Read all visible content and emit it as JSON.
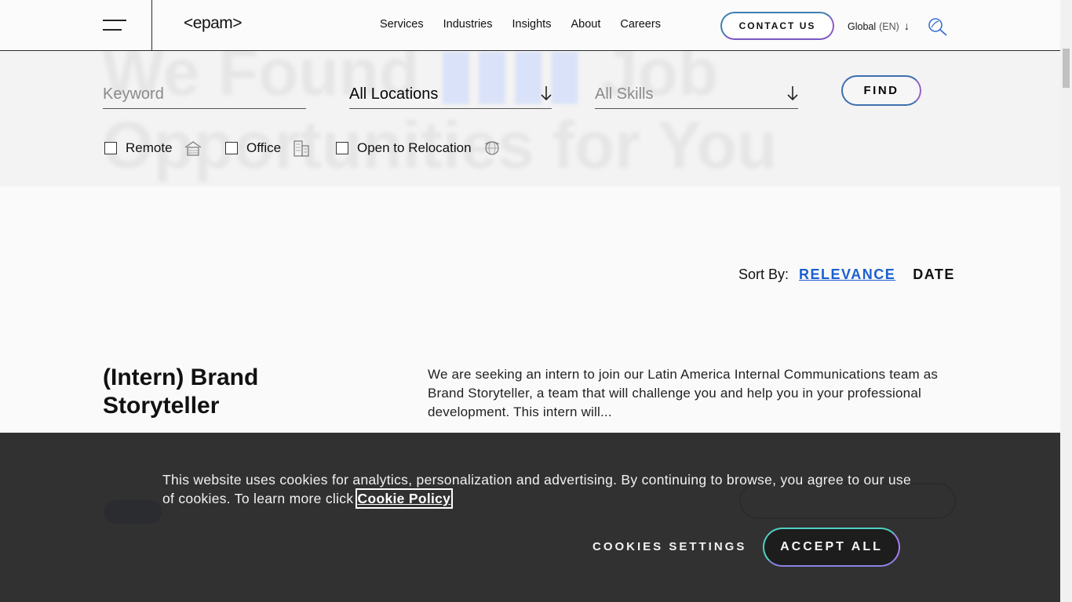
{
  "header": {
    "logo": "<epam>",
    "nav": [
      "Services",
      "Industries",
      "Insights",
      "About",
      "Careers"
    ],
    "contact_label": "CONTACT US",
    "lang_region": "Global",
    "lang_code": "(EN)"
  },
  "filters": {
    "keyword_placeholder": "Keyword",
    "location_value": "All Locations",
    "skills_value": "All Skills",
    "find_label": "FIND",
    "checkboxes": [
      {
        "label": "Remote",
        "checked": false,
        "icon": "house-icon"
      },
      {
        "label": "Office",
        "checked": false,
        "icon": "building-icon"
      },
      {
        "label": "Open to Relocation",
        "checked": false,
        "icon": "globe-icon"
      }
    ]
  },
  "sort": {
    "label": "Sort By:",
    "relevance": "RELEVANCE",
    "date": "DATE",
    "active": "RELEVANCE"
  },
  "job": {
    "title": "(Intern) Brand Storyteller",
    "description": "We are seeking an intern to join our Latin America Internal Communications team as Brand Storyteller, a team that will challenge you and help you in your professional development. This intern will..."
  },
  "cookie": {
    "message": "This website uses cookies for analytics, personalization and advertising. By continuing to browse, you agree to our use of cookies. To learn more click ",
    "policy_link": "Cookie Policy",
    "settings_label": "COOKIES SETTINGS",
    "accept_label": "ACCEPT ALL"
  },
  "colors": {
    "accent_blue": "#1a5fd0",
    "banner_bg": "#2a2a2a"
  }
}
